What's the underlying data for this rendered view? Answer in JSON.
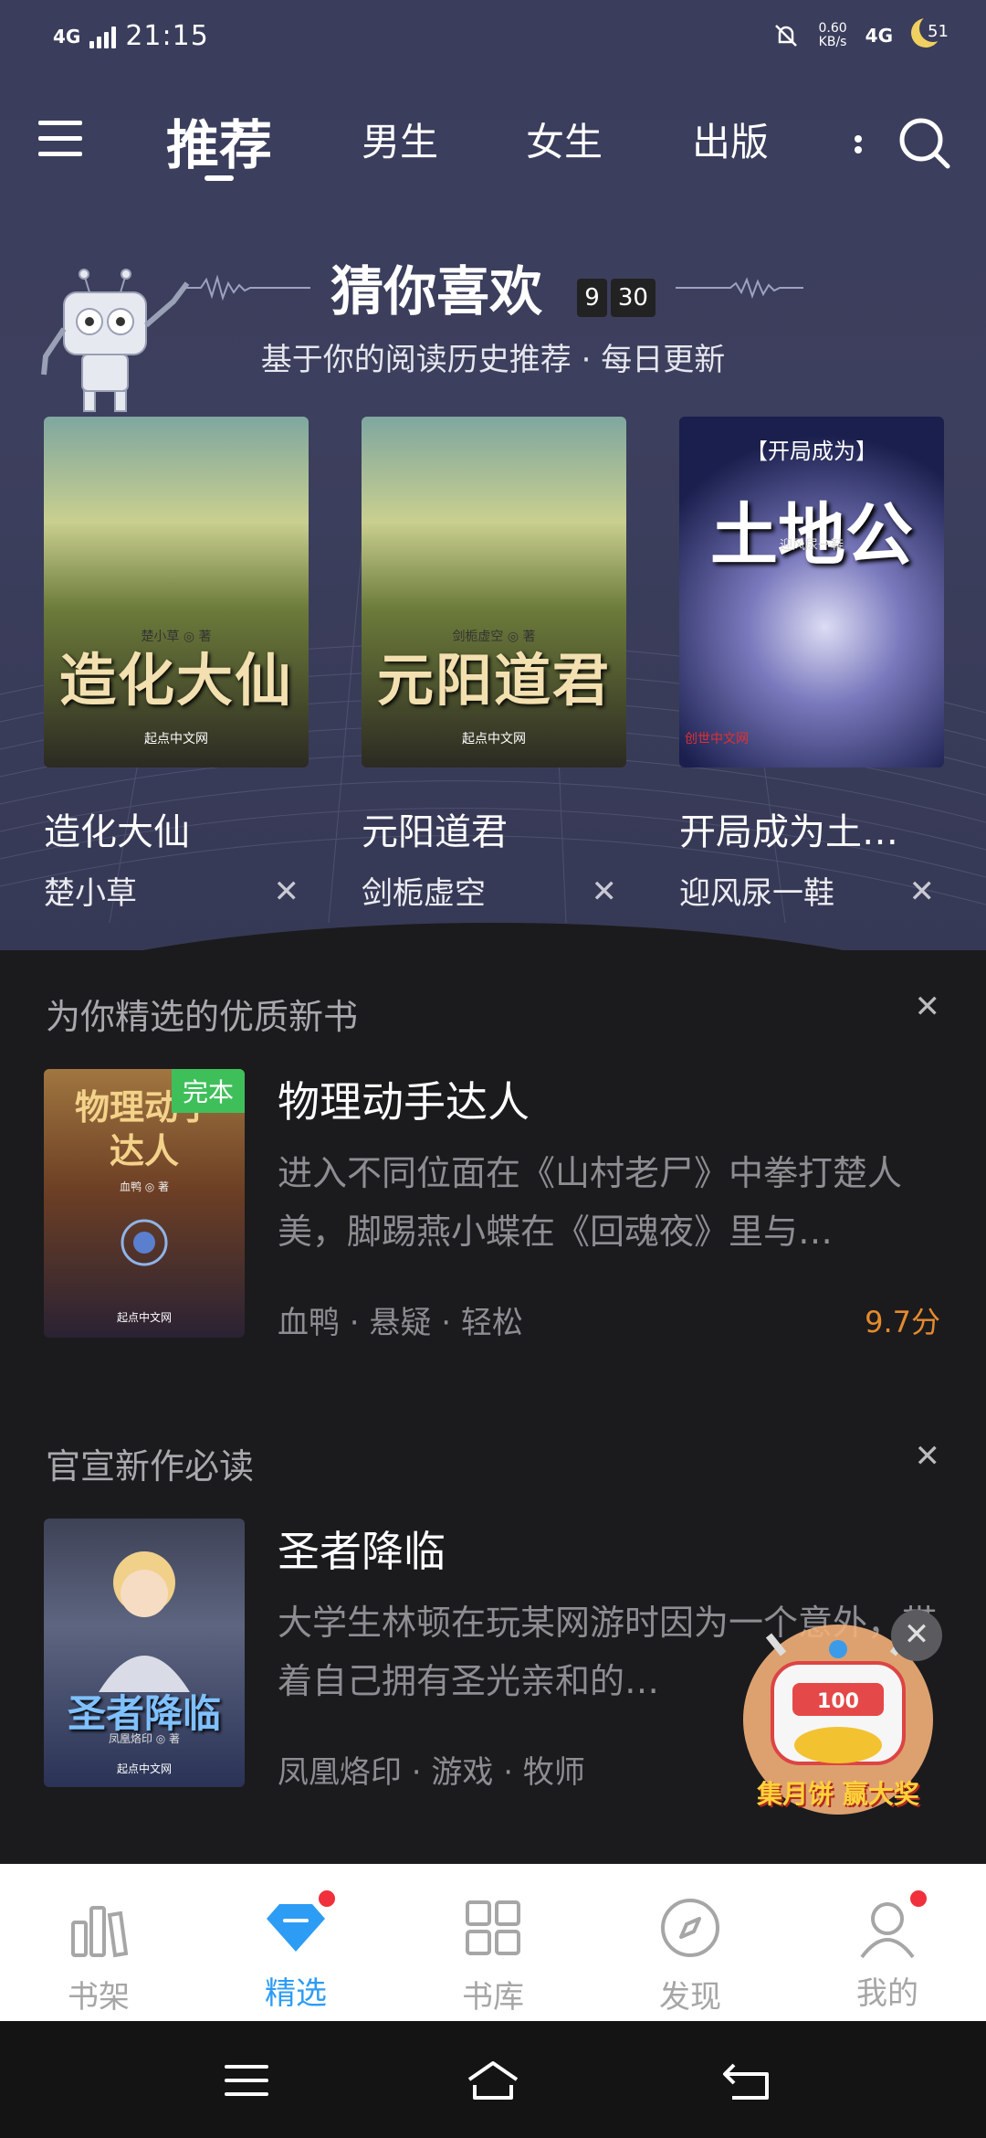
{
  "status_bar": {
    "network": "4G",
    "time": "21:15",
    "speed_value": "0.60",
    "speed_unit": "KB/s",
    "network_right": "4G",
    "battery": "51"
  },
  "top_nav": {
    "tabs": [
      "推荐",
      "男生",
      "女生",
      "出版"
    ],
    "active_tab": "推荐"
  },
  "guess": {
    "title": "猜你喜欢",
    "date_month": "9",
    "date_day": "30",
    "subtitle": "基于你的阅读历史推荐 · 每日更新",
    "books": [
      {
        "name": "造化大仙",
        "author": "楚小草",
        "cover_title": "造化大仙",
        "cover_author": "楚小草 ◎ 著",
        "cover_logo": "起点中文网"
      },
      {
        "name": "元阳道君",
        "author": "剑栀虚空",
        "cover_title": "元阳道君",
        "cover_author": "剑栀虚空 ◎ 著",
        "cover_logo": "起点中文网"
      },
      {
        "name": "开局成为土…",
        "author": "迎风尿一鞋",
        "cover_tag": "【开局成为】",
        "cover_title": "土地公",
        "cover_author": "迎风尿一鞋",
        "cover_logo": "创世中文网"
      }
    ],
    "close_symbol": "✕"
  },
  "section1": {
    "title": "为你精选的优质新书",
    "close_symbol": "✕",
    "book": {
      "badge": "完本",
      "cover_title": "物理动手达人",
      "cover_author": "血鸭 ◎ 著",
      "cover_logo": "起点中文网",
      "title": "物理动手达人",
      "desc": "进入不同位面在《山村老尸》中拳打楚人美，脚踢燕小蝶在《回魂夜》里与…",
      "meta": "血鸭 · 悬疑 · 轻松",
      "score": "9.7分"
    }
  },
  "section2": {
    "title": "官宣新作必读",
    "close_symbol": "✕",
    "book": {
      "cover_title": "圣者降临",
      "cover_author": "凤凰烙印 ◎ 著",
      "cover_logo": "起点中文网",
      "title": "圣者降临",
      "desc": "大学生林顿在玩某网游时因为一个意外，带着自己拥有圣光亲和的…",
      "meta": "凤凰烙印 · 游戏 · 牧师"
    }
  },
  "promo": {
    "counter": "100",
    "label": "集月饼 赢大奖",
    "close_symbol": "✕"
  },
  "tabbar": {
    "items": [
      {
        "label": "书架",
        "icon": "bookshelf-icon"
      },
      {
        "label": "精选",
        "icon": "diamond-icon"
      },
      {
        "label": "书库",
        "icon": "grid-icon"
      },
      {
        "label": "发现",
        "icon": "compass-icon"
      },
      {
        "label": "我的",
        "icon": "user-icon"
      }
    ],
    "active": "精选",
    "accent_color": "#2d9cf5"
  }
}
